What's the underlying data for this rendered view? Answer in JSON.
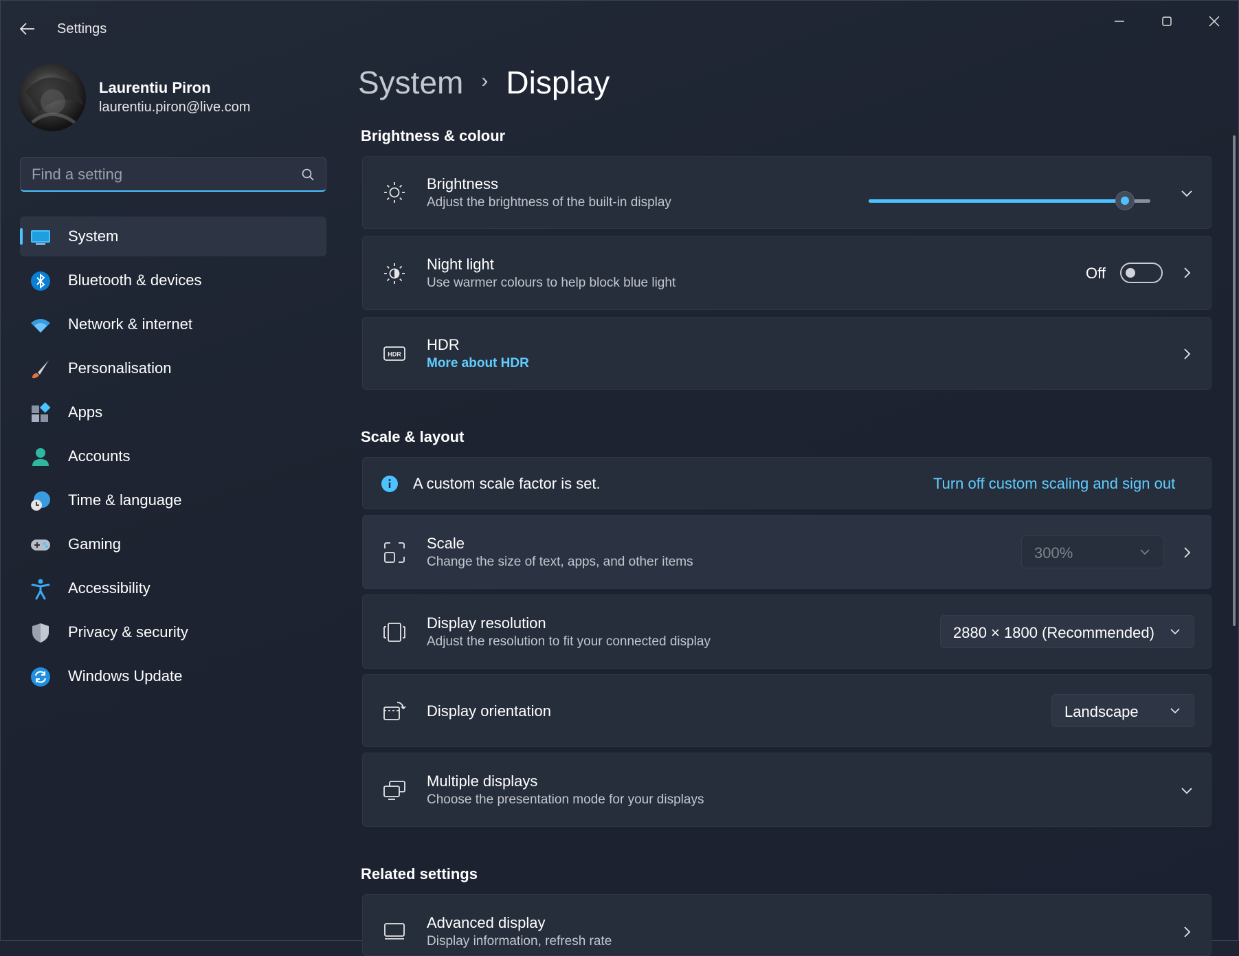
{
  "window": {
    "title": "Settings"
  },
  "profile": {
    "name": "Laurentiu Piron",
    "email": "laurentiu.piron@live.com"
  },
  "search": {
    "placeholder": "Find a setting",
    "value": ""
  },
  "sidebar": {
    "items": [
      {
        "label": "System",
        "icon": "system-icon",
        "active": true
      },
      {
        "label": "Bluetooth & devices",
        "icon": "bluetooth-icon"
      },
      {
        "label": "Network & internet",
        "icon": "wifi-icon"
      },
      {
        "label": "Personalisation",
        "icon": "brush-icon"
      },
      {
        "label": "Apps",
        "icon": "apps-icon"
      },
      {
        "label": "Accounts",
        "icon": "person-icon"
      },
      {
        "label": "Time & language",
        "icon": "globe-clock-icon"
      },
      {
        "label": "Gaming",
        "icon": "gamepad-icon"
      },
      {
        "label": "Accessibility",
        "icon": "accessibility-icon"
      },
      {
        "label": "Privacy & security",
        "icon": "shield-icon"
      },
      {
        "label": "Windows Update",
        "icon": "update-icon"
      }
    ]
  },
  "breadcrumb": {
    "parent": "System",
    "separator": "›",
    "current": "Display"
  },
  "sections": {
    "brightness": {
      "title": "Brightness & colour",
      "brightness": {
        "title": "Brightness",
        "subtitle": "Adjust the brightness of the built-in display",
        "level": 0.91
      },
      "night_light": {
        "title": "Night light",
        "subtitle": "Use warmer colours to help block blue light",
        "state_label": "Off",
        "on": false
      },
      "hdr": {
        "title": "HDR",
        "link": "More about HDR"
      }
    },
    "scale_layout": {
      "title": "Scale & layout",
      "info": {
        "message": "A custom scale factor is set.",
        "link": "Turn off custom scaling and sign out"
      },
      "scale": {
        "title": "Scale",
        "subtitle": "Change the size of text, apps, and other items",
        "value": "300%"
      },
      "resolution": {
        "title": "Display resolution",
        "subtitle": "Adjust the resolution to fit your connected display",
        "value": "2880 × 1800 (Recommended)"
      },
      "orientation": {
        "title": "Display orientation",
        "value": "Landscape"
      },
      "multiple": {
        "title": "Multiple displays",
        "subtitle": "Choose the presentation mode for your displays"
      }
    },
    "related": {
      "title": "Related settings",
      "advanced": {
        "title": "Advanced display",
        "subtitle": "Display information, refresh rate"
      }
    }
  },
  "colors": {
    "accent": "#4cc2ff",
    "link": "#60cdff",
    "background": "#1e2431",
    "card": "#262d3b"
  }
}
